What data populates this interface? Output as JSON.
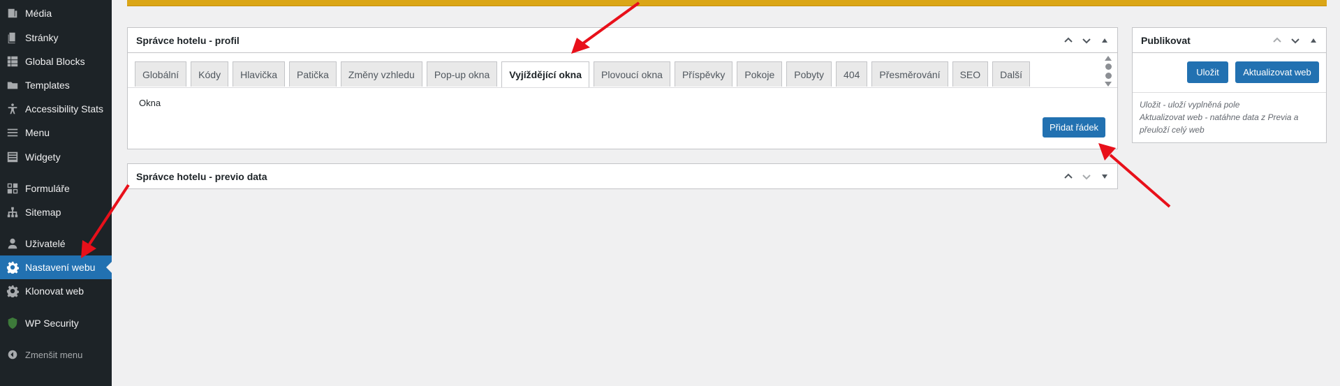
{
  "sidebar": {
    "items": [
      {
        "label": "Média",
        "icon": "media-icon"
      },
      {
        "label": "Stránky",
        "icon": "pages-icon"
      },
      {
        "label": "Global Blocks",
        "icon": "blocks-icon"
      },
      {
        "label": "Templates",
        "icon": "folder-icon"
      },
      {
        "label": "Accessibility Stats",
        "icon": "accessibility-icon"
      },
      {
        "label": "Menu",
        "icon": "menu-icon"
      },
      {
        "label": "Widgety",
        "icon": "widgets-icon"
      },
      {
        "label": "Formuláře",
        "icon": "forms-icon"
      },
      {
        "label": "Sitemap",
        "icon": "sitemap-icon"
      },
      {
        "label": "Uživatelé",
        "icon": "user-icon"
      },
      {
        "label": "Nastavení webu",
        "icon": "gear-icon"
      },
      {
        "label": "Klonovat web",
        "icon": "gear-icon"
      },
      {
        "label": "WP Security",
        "icon": "shield-icon"
      }
    ],
    "collapse_label": "Zmenšit menu"
  },
  "profile_box": {
    "title": "Správce hotelu - profil",
    "tabs": [
      "Globální",
      "Kódy",
      "Hlavička",
      "Patička",
      "Změny vzhledu",
      "Pop-up okna",
      "Vyjíždějící okna",
      "Plovoucí okna",
      "Příspěvky",
      "Pokoje",
      "Pobyty",
      "404",
      "Přesměrování",
      "SEO",
      "Další"
    ],
    "active_tab": "Vyjíždějící okna",
    "section_label": "Okna",
    "add_row_label": "Přidat řádek"
  },
  "previo_box": {
    "title": "Správce hotelu - previo data"
  },
  "publish_box": {
    "title": "Publikovat",
    "save_label": "Uložit",
    "update_label": "Aktualizovat web",
    "note_line1": "Uložit - uloží vyplněná pole",
    "note_line2": "Aktualizovat web - natáhne data z Previa a",
    "note_line3": "přeuloží celý web"
  },
  "colors": {
    "accent": "#2271b1",
    "notice": "#dba617",
    "sidebar_bg": "#1d2327",
    "annotation_arrow": "#e8101a"
  }
}
